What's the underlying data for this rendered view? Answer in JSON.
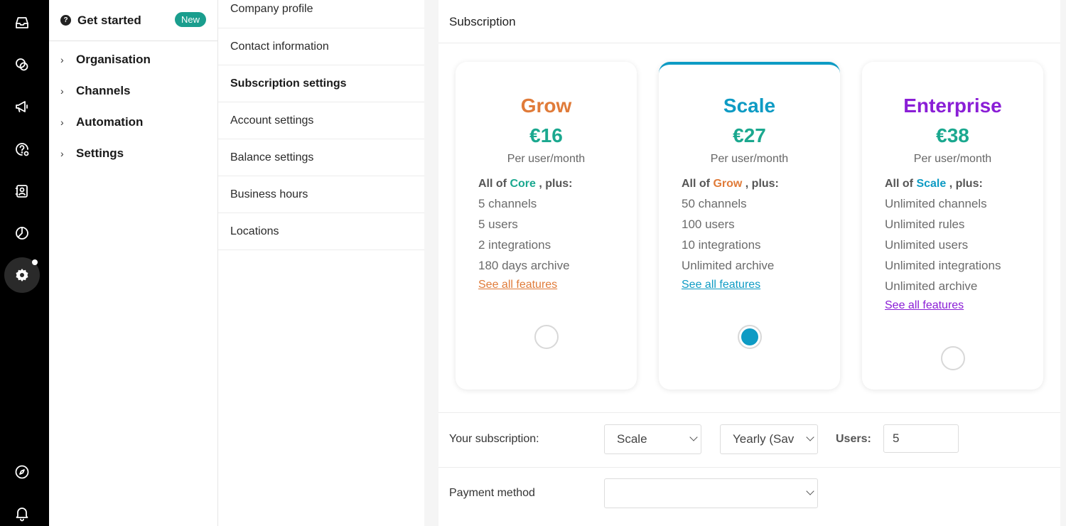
{
  "rail": {
    "icons": [
      "inbox-icon",
      "conversations-icon",
      "megaphone-icon",
      "help-settings-icon",
      "contacts-icon",
      "reports-icon",
      "settings-icon",
      "compass-icon",
      "bell-icon"
    ]
  },
  "nav": {
    "get_started": "Get started",
    "badge": "New",
    "groups": [
      "Organisation",
      "Channels",
      "Automation",
      "Settings"
    ]
  },
  "submenu": {
    "items": [
      "Company profile",
      "Contact information",
      "Subscription settings",
      "Account settings",
      "Balance settings",
      "Business hours",
      "Locations"
    ],
    "active": "Subscription settings"
  },
  "main": {
    "title": "Subscription",
    "plans": [
      {
        "name": "Grow",
        "name_color": "#e07b39",
        "price": "€16",
        "per": "Per user/month",
        "plus_prefix": "All of ",
        "plus_ref": "Core",
        "plus_ref_color": "#1ba88f",
        "plus_suffix": " , plus:",
        "features": [
          "5 channels",
          "5 users",
          "2 integrations",
          "180 days archive"
        ],
        "link": "See all features",
        "link_color": "#e07b39",
        "selected": false
      },
      {
        "name": "Scale",
        "name_color": "#0e9bc4",
        "price": "€27",
        "per": "Per user/month",
        "plus_prefix": "All of ",
        "plus_ref": "Grow",
        "plus_ref_color": "#e07b39",
        "plus_suffix": " , plus:",
        "features": [
          "50 channels",
          "100 users",
          "10 integrations",
          "Unlimited archive"
        ],
        "link": "See all features",
        "link_color": "#0e9bc4",
        "selected": true
      },
      {
        "name": "Enterprise",
        "name_color": "#8a1ed6",
        "price": "€38",
        "per": "Per user/month",
        "plus_prefix": "All of ",
        "plus_ref": "Scale",
        "plus_ref_color": "#0e9bc4",
        "plus_suffix": " , plus:",
        "features": [
          "Unlimited channels",
          "Unlimited rules",
          "Unlimited users",
          "Unlimited integrations",
          "Unlimited archive"
        ],
        "link": "See all features",
        "link_color": "#8a1ed6",
        "selected": false
      }
    ],
    "subscription_label": "Your subscription:",
    "plan_select": "Scale",
    "period_select": "Yearly (Sav",
    "users_label": "Users:",
    "users_value": "5",
    "payment_label": "Payment method",
    "payment_value": ""
  }
}
